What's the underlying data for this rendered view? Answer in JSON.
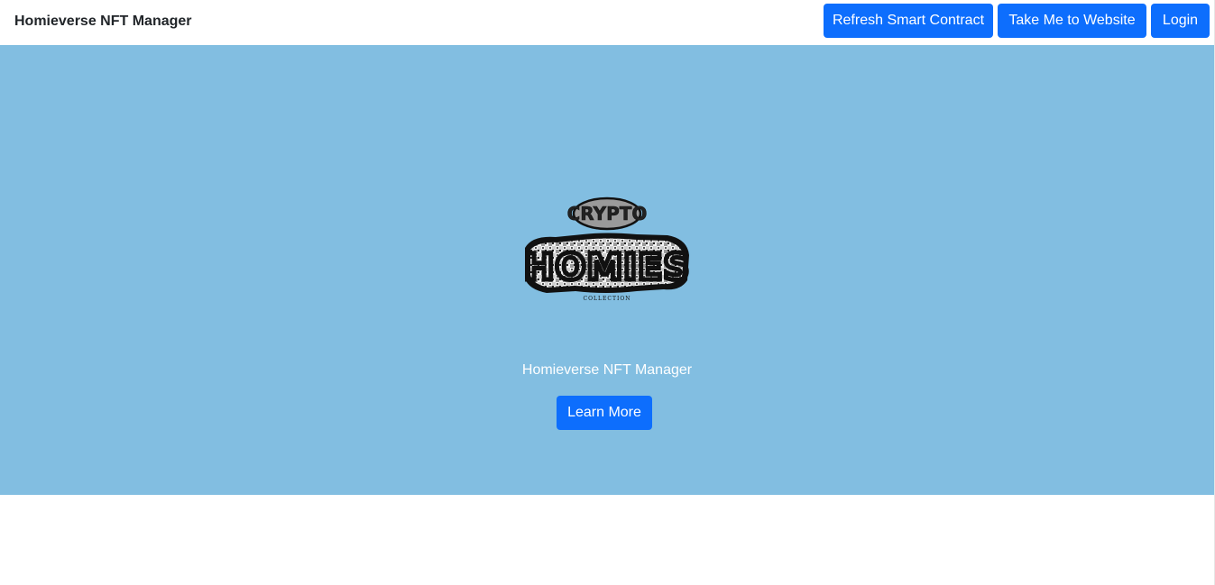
{
  "header": {
    "brand": "Homieverse NFT Manager",
    "buttons": {
      "refresh": "Refresh Smart Contract",
      "website": "Take Me to Website",
      "login": "Login"
    }
  },
  "hero": {
    "logo": {
      "top_text": "CRYPTO",
      "main_text": "HOMIES",
      "bottom_text": "COLLECTION"
    },
    "title": "Homieverse NFT Manager",
    "cta": "Learn More"
  },
  "colors": {
    "primary": "#0d6efd",
    "hero_background": "#82bee1",
    "text_dark": "#212529"
  }
}
